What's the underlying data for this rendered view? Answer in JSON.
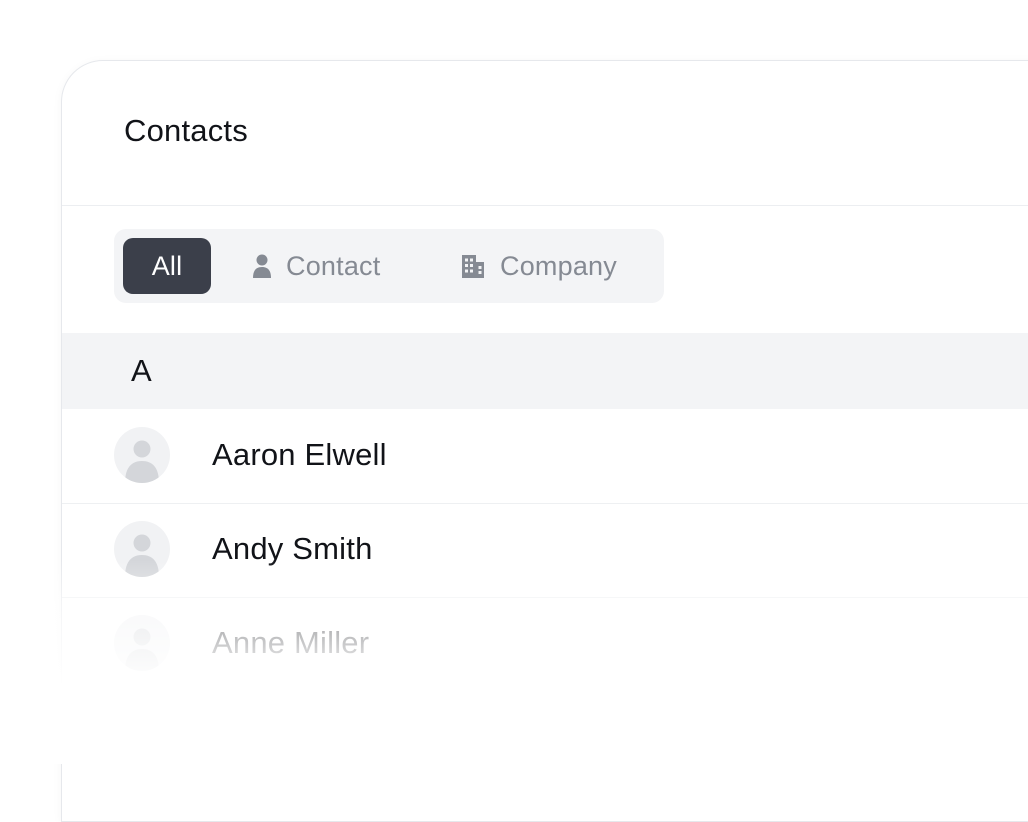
{
  "header": {
    "title": "Contacts"
  },
  "filters": {
    "all_label": "All",
    "contact_label": "Contact",
    "company_label": "Company",
    "selected": "All",
    "contact_icon": "person-icon",
    "company_icon": "building-icon"
  },
  "list": {
    "sections": [
      {
        "letter": "A",
        "contacts": [
          {
            "name": "Aaron Elwell"
          },
          {
            "name": "Andy Smith"
          },
          {
            "name": "Anne Miller"
          }
        ]
      }
    ]
  },
  "colors": {
    "active_chip_bg": "#3b3f4a",
    "filter_bar_bg": "#f3f4f6",
    "section_bg": "#f3f4f6",
    "text_primary": "#111318",
    "text_muted": "#858a93"
  }
}
